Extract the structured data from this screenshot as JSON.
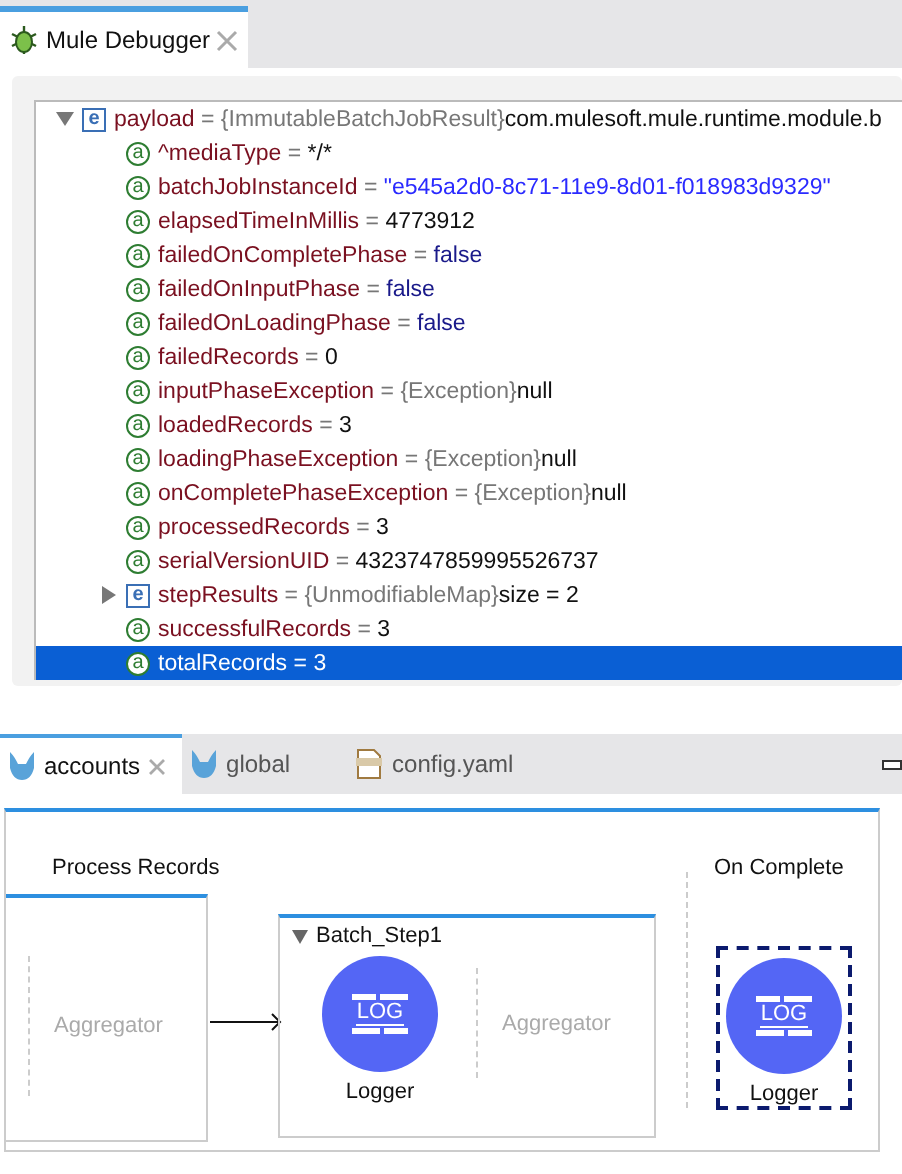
{
  "debugger_tab": {
    "title": "Mule Debugger"
  },
  "variables": [
    {
      "kind": "object",
      "badge": "e",
      "expanded": true,
      "selected": false,
      "name": "payload",
      "op": "=",
      "type_label": "{ImmutableBatchJobResult}",
      "value": "com.mulesoft.mule.runtime.module.b",
      "children": [
        {
          "kind": "value",
          "badge": "a",
          "selected": false,
          "name": "^mediaType",
          "op": "=",
          "value": "*/*"
        },
        {
          "kind": "string",
          "badge": "a",
          "selected": false,
          "name": "batchJobInstanceId",
          "op": "=",
          "value": "\"e545a2d0-8c71-11e9-8d01-f018983d9329\""
        },
        {
          "kind": "value",
          "badge": "a",
          "selected": false,
          "name": "elapsedTimeInMillis",
          "op": "=",
          "value": "4773912"
        },
        {
          "kind": "boolean",
          "badge": "a",
          "selected": false,
          "name": "failedOnCompletePhase",
          "op": "=",
          "value": "false"
        },
        {
          "kind": "boolean",
          "badge": "a",
          "selected": false,
          "name": "failedOnInputPhase",
          "op": "=",
          "value": "false"
        },
        {
          "kind": "boolean",
          "badge": "a",
          "selected": false,
          "name": "failedOnLoadingPhase",
          "op": "=",
          "value": "false"
        },
        {
          "kind": "value",
          "badge": "a",
          "selected": false,
          "name": "failedRecords",
          "op": "=",
          "value": "0"
        },
        {
          "kind": "value",
          "badge": "a",
          "selected": false,
          "name": "inputPhaseException",
          "op": "=",
          "type_label": "{Exception}",
          "value": "null"
        },
        {
          "kind": "value",
          "badge": "a",
          "selected": false,
          "name": "loadedRecords",
          "op": "=",
          "value": "3"
        },
        {
          "kind": "value",
          "badge": "a",
          "selected": false,
          "name": "loadingPhaseException",
          "op": "=",
          "type_label": "{Exception}",
          "value": "null"
        },
        {
          "kind": "value",
          "badge": "a",
          "selected": false,
          "name": "onCompletePhaseException",
          "op": "=",
          "type_label": "{Exception}",
          "value": "null"
        },
        {
          "kind": "value",
          "badge": "a",
          "selected": false,
          "name": "processedRecords",
          "op": "=",
          "value": "3"
        },
        {
          "kind": "value",
          "badge": "a",
          "selected": false,
          "name": "serialVersionUID",
          "op": "=",
          "value": "4323747859995526737"
        },
        {
          "kind": "object",
          "badge": "e",
          "expanded": false,
          "selected": false,
          "name": "stepResults",
          "op": "=",
          "type_label": "{UnmodifiableMap}",
          "value": "size = 2"
        },
        {
          "kind": "value",
          "badge": "a",
          "selected": false,
          "name": "successfulRecords",
          "op": "=",
          "value": "3"
        },
        {
          "kind": "value",
          "badge": "a",
          "selected": true,
          "name": "totalRecords",
          "op": "=",
          "value": "3"
        }
      ]
    }
  ],
  "editor_tabs": [
    {
      "label": "accounts",
      "selected": true
    },
    {
      "label": "global",
      "selected": false
    },
    {
      "label": "config.yaml",
      "selected": false
    }
  ],
  "flow": {
    "process_title": "Process Records",
    "aggregator_left": "Aggregator",
    "step": {
      "title": "Batch_Step1",
      "expanded": true,
      "logger": {
        "icon_text": "LOG",
        "label": "Logger",
        "selected": false
      },
      "aggregator": "Aggregator"
    },
    "complete_title": "On Complete",
    "complete_logger": {
      "icon_text": "LOG",
      "label": "Logger",
      "selected": true
    }
  }
}
